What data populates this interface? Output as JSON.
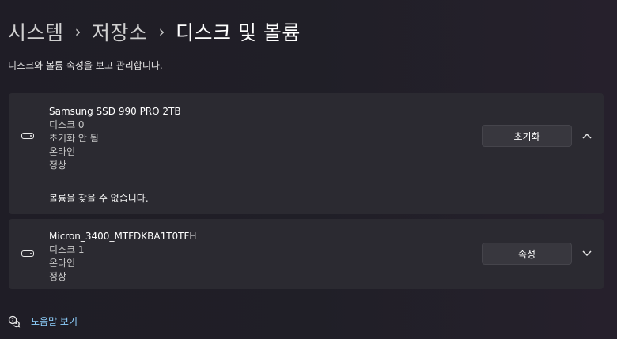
{
  "breadcrumb": {
    "items": [
      "시스템",
      "저장소"
    ],
    "current": "디스크 및 볼륨",
    "separator": "›"
  },
  "subtitle": "디스크와 볼륨 속성을 보고 관리합니다.",
  "disks": [
    {
      "name": "Samsung SSD 990 PRO 2TB",
      "details": [
        "디스크 0",
        "초기화 안 됨",
        "온라인",
        "정상"
      ],
      "button_label": "초기화",
      "expanded": true,
      "chevron_icon": "chevron-up-icon",
      "volumes_message": "볼륨을 찾을 수 없습니다."
    },
    {
      "name": "Micron_3400_MTFDKBA1T0TFH",
      "details": [
        "디스크 1",
        "온라인",
        "정상"
      ],
      "button_label": "속성",
      "expanded": false,
      "chevron_icon": "chevron-down-icon"
    }
  ],
  "help": {
    "label": "도움말 보기",
    "icon": "help-chat-icon"
  },
  "colors": {
    "link": "#8fd1ff",
    "card": "#2b2a31",
    "button": "#38373e"
  }
}
